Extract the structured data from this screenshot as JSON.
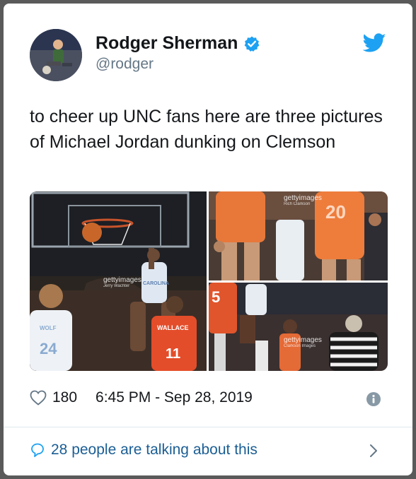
{
  "tweet": {
    "author": {
      "display_name": "Rodger Sherman",
      "handle": "@rodger",
      "verified": true,
      "avatar_icon": "avatar-photo"
    },
    "text": "to cheer up UNC fans here are three pictures of Michael Jordan dunking on Clemson",
    "media": {
      "photos": [
        {
          "watermark": "gettyimages",
          "credit": "Jerry Wachter",
          "jersey_labels": [
            "24",
            "WOLF",
            "CAROLINA",
            "WALLACE",
            "11"
          ]
        },
        {
          "watermark": "gettyimages",
          "credit": "Rich Clarkson",
          "jersey_labels": [
            "20"
          ]
        },
        {
          "watermark": "gettyimages",
          "credit": "Clarkson Images",
          "jersey_labels": [
            "5"
          ]
        }
      ]
    },
    "likes": "180",
    "timestamp": "6:45 PM - Sep 28, 2019",
    "talking": "28 people are talking about this"
  },
  "icons": {
    "verified": "verified-badge-icon",
    "platform": "twitter-bird-icon",
    "like": "heart-outline-icon",
    "info": "info-icon",
    "comment": "comment-bubble-icon",
    "chevron": "chevron-right-icon"
  },
  "colors": {
    "brand_blue": "#1da1f2",
    "link_blue": "#1b5e94",
    "text": "#14171a",
    "secondary_text": "#657786",
    "border": "#e1e8ed",
    "backdrop": "#5a5a5a"
  }
}
